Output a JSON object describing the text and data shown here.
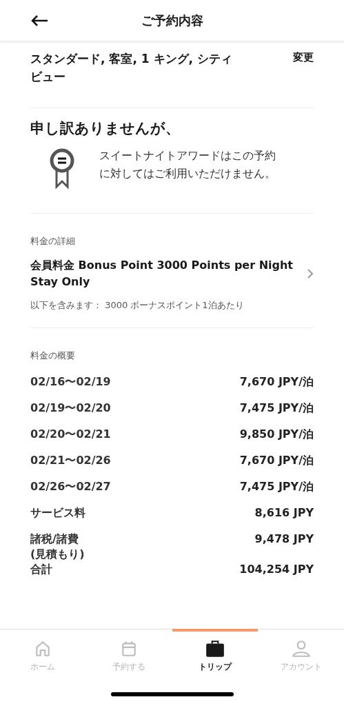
{
  "header": {
    "title": "ご予約内容"
  },
  "room": {
    "name": "スタンダード, 客室, 1 キング, シティビュー",
    "change_link": "変更"
  },
  "notice": {
    "heading": "申し訳ありませんが、",
    "message": "スイートナイトアワードはこの予約に対してはご利用いただけません。"
  },
  "rate_details": {
    "label": "料金の詳細",
    "rate_name": "会員料金 Bonus Point 3000 Points per Night Stay Only",
    "includes": "以下を含みます： 3000 ボーナスポイント1泊あたり"
  },
  "summary": {
    "label": "料金の概要",
    "rows": [
      {
        "label": "02/16〜02/19",
        "amount": "7,670 JPY/泊"
      },
      {
        "label": "02/19〜02/20",
        "amount": "7,475 JPY/泊"
      },
      {
        "label": "02/20〜02/21",
        "amount": "9,850 JPY/泊"
      },
      {
        "label": "02/21〜02/26",
        "amount": "7,670 JPY/泊"
      },
      {
        "label": "02/26〜02/27",
        "amount": "7,475 JPY/泊"
      },
      {
        "label": "サービス料",
        "amount": "8,616 JPY"
      },
      {
        "label": "諸税/諸費\n(見積もり)",
        "amount": "9,478 JPY"
      },
      {
        "label": "合計",
        "amount": "104,254 JPY"
      }
    ]
  },
  "tab_bar": [
    {
      "label": "ホーム",
      "selected": false
    },
    {
      "label": "予約する",
      "selected": false
    },
    {
      "label": "トリップ",
      "selected": true
    },
    {
      "label": "アカウント",
      "selected": false
    }
  ]
}
